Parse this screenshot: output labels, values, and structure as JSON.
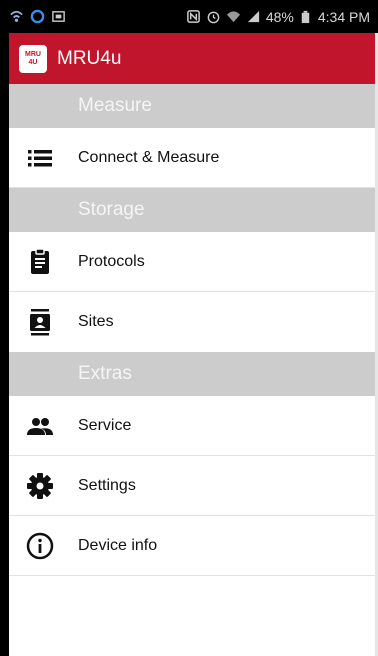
{
  "status_bar": {
    "battery": "48%",
    "time": "4:34 PM",
    "icons_left": [
      "wifi-call-icon",
      "sync-icon",
      "image-icon"
    ],
    "icons_right": [
      "nfc-icon",
      "alarm-icon",
      "wifi-icon",
      "signal-icon",
      "battery-icon"
    ]
  },
  "app": {
    "title": "MRU4u",
    "logo_top": "MRU",
    "logo_bottom": "4U",
    "brand_color": "#c0152b"
  },
  "menu": {
    "sections": [
      {
        "header": "Measure",
        "items": [
          {
            "label": "Connect & Measure",
            "icon": "list-icon"
          }
        ]
      },
      {
        "header": "Storage",
        "items": [
          {
            "label": "Protocols",
            "icon": "clipboard-icon"
          },
          {
            "label": "Sites",
            "icon": "contact-card-icon"
          }
        ]
      },
      {
        "header": "Extras",
        "items": [
          {
            "label": "Service",
            "icon": "people-icon"
          },
          {
            "label": "Settings",
            "icon": "gear-icon"
          },
          {
            "label": "Device info",
            "icon": "info-icon"
          }
        ]
      }
    ]
  }
}
